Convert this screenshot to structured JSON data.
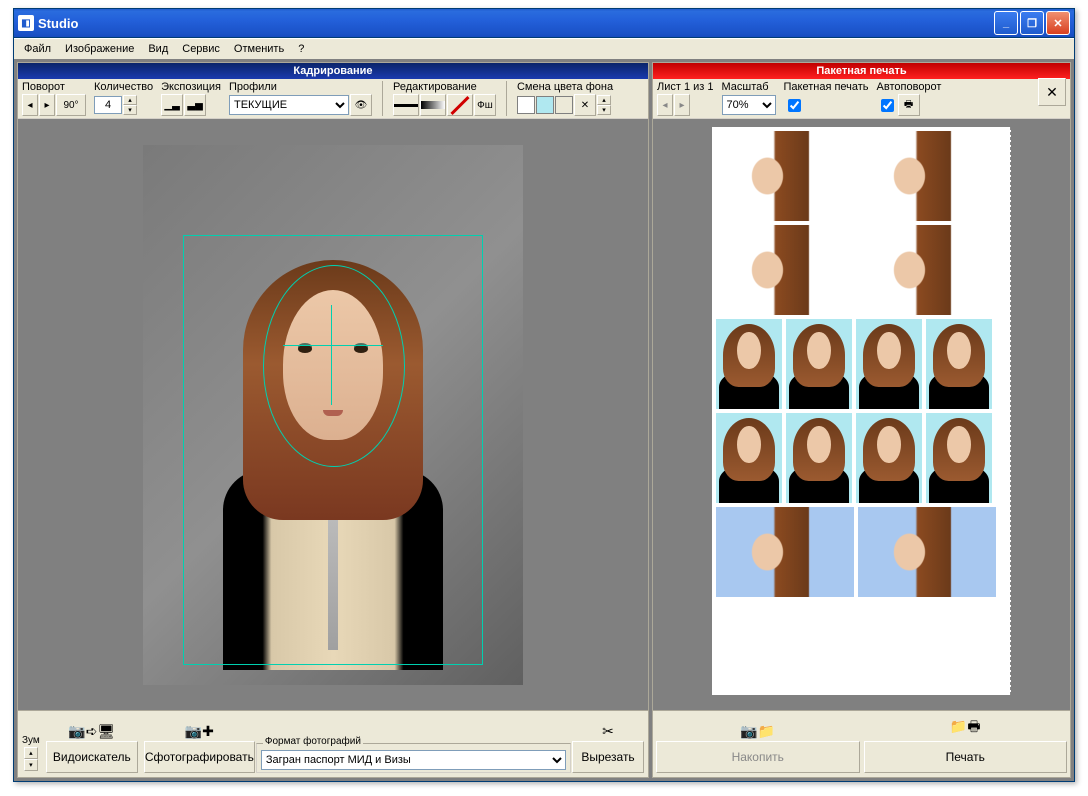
{
  "window": {
    "title": "Studio"
  },
  "menu": [
    "Файл",
    "Изображение",
    "Вид",
    "Сервис",
    "Отменить",
    "?"
  ],
  "leftPane": {
    "title": "Кадрирование",
    "rotation": {
      "label": "Поворот",
      "ninety": "90°"
    },
    "quantity": {
      "label": "Количество",
      "value": "4"
    },
    "exposure": {
      "label": "Экспозиция"
    },
    "profiles": {
      "label": "Профили",
      "value": "ТЕКУЩИЕ"
    },
    "editing": {
      "label": "Редактирование",
      "ps": "Фш"
    },
    "bgchange": {
      "label": "Смена цвета фона"
    }
  },
  "rightPane": {
    "title": "Пакетная печать",
    "sheet": {
      "label": "Лист 1 из 1"
    },
    "scale": {
      "label": "Масштаб",
      "value": "70%"
    },
    "batch": {
      "label": "Пакетная печать"
    },
    "autorotate": {
      "label": "Автоповорот"
    }
  },
  "bottom": {
    "zoom": {
      "label": "Зум"
    },
    "viewfinder": {
      "label": "Видоискатель"
    },
    "shoot": {
      "label": "Сфотографировать"
    },
    "format": {
      "legend": "Формат фотографий",
      "value": "Загран паспорт МИД и Визы"
    },
    "cut": {
      "label": "Вырезать"
    },
    "stock": {
      "label": "Накопить"
    },
    "print": {
      "label": "Печать"
    }
  }
}
